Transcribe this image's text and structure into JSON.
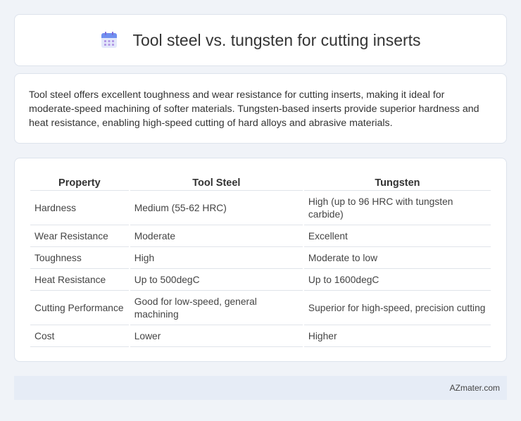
{
  "header": {
    "title": "Tool steel vs. tungsten for cutting inserts",
    "icon": "calendar-icon"
  },
  "intro": {
    "text": "Tool steel offers excellent toughness and wear resistance for cutting inserts, making it ideal for moderate-speed machining of softer materials. Tungsten-based inserts provide superior hardness and heat resistance, enabling high-speed cutting of hard alloys and abrasive materials."
  },
  "table": {
    "headers": [
      "Property",
      "Tool Steel",
      "Tungsten"
    ],
    "rows": [
      [
        "Hardness",
        "Medium (55-62 HRC)",
        "High (up to 96 HRC with tungsten carbide)"
      ],
      [
        "Wear Resistance",
        "Moderate",
        "Excellent"
      ],
      [
        "Toughness",
        "High",
        "Moderate to low"
      ],
      [
        "Heat Resistance",
        "Up to 500degC",
        "Up to 1600degC"
      ],
      [
        "Cutting Performance",
        "Good for low-speed, general machining",
        "Superior for high-speed, precision cutting"
      ],
      [
        "Cost",
        "Lower",
        "Higher"
      ]
    ]
  },
  "footer": {
    "brand": "AZmater.com"
  }
}
